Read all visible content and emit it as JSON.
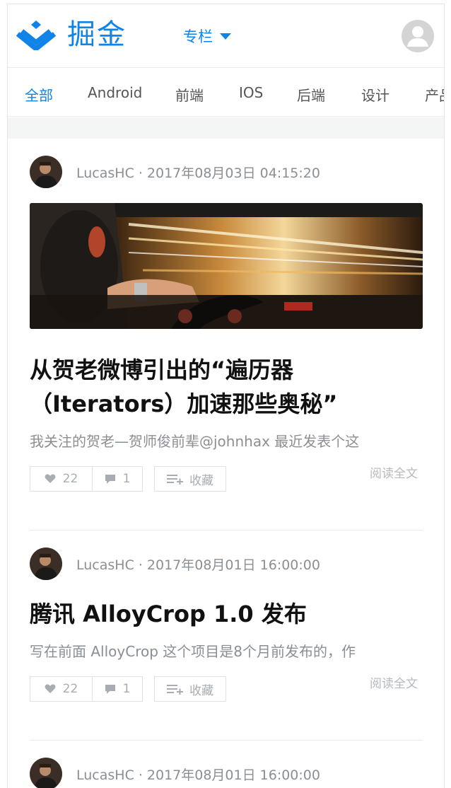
{
  "header": {
    "logo_text": "掘金",
    "column_select": "专栏"
  },
  "tabs": [
    "全部",
    "Android",
    "前端",
    "IOS",
    "后端",
    "设计",
    "产品"
  ],
  "articles": [
    {
      "author": "LucasHC",
      "date": "2017年08月03日 04:15:20",
      "title": "从贺老微博引出的“遍历器（Iterators）加速那些奥秘”",
      "excerpt": "我关注的贺老—贺师俊前辈@johnhax 最近发表个这",
      "likes": "22",
      "comments": "1",
      "collect_label": "收藏",
      "read_more": "阅读全文"
    },
    {
      "author": "LucasHC",
      "date": "2017年08月01日 16:00:00",
      "title": "腾讯 AlloyCrop 1.0 发布",
      "excerpt": "写在前面 AlloyCrop 这个项目是8个月前发布的，作",
      "likes": "22",
      "comments": "1",
      "collect_label": "收藏",
      "read_more": "阅读全文"
    },
    {
      "author": "LucasHC",
      "date": "2017年08月01日 16:00:00"
    }
  ],
  "colors": {
    "brand": "#0f83e8",
    "meta": "#8a8f94",
    "border": "#dfe3e6"
  },
  "icons": [
    "juejin-logo-icon",
    "chevron-down-icon",
    "user-icon",
    "heart-icon",
    "comment-icon",
    "collect-add-icon"
  ]
}
